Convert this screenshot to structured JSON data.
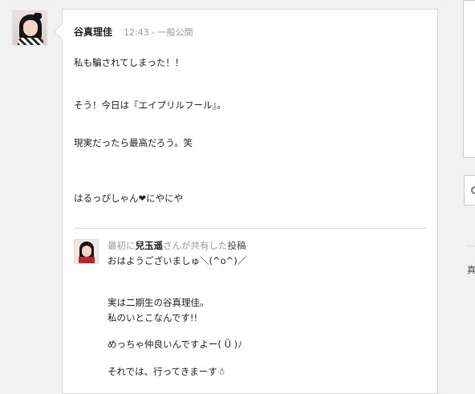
{
  "post": {
    "author": "谷真理佳",
    "time": "12:43",
    "separator": "-",
    "visibility": "一般公開",
    "lines": [
      "私も騙されてしまった！！",
      "そう！今日は『エイプリルフール』。",
      "現実だったら最高だろう。笑",
      "はるっぴしゃん"
    ],
    "heart": "❤",
    "tail": "にやにや"
  },
  "shared": {
    "prefix": "最初に",
    "name": "兒玉遥",
    "mid": "さんが共有した",
    "post_word": "投稿",
    "lines": [
      "おはようございましゅ＼(^o^)／",
      "実は二期生の谷真理佳。",
      "私のいとこなんです!!",
      "めっちゃ仲良いんですよー( Ü )ﾉ",
      "それでは、行ってきまーす☃"
    ]
  },
  "right": {
    "text": "真"
  }
}
